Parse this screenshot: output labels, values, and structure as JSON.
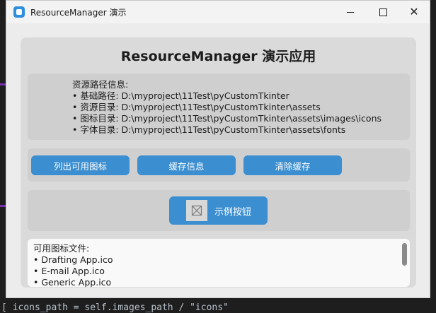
{
  "window": {
    "title": "ResourceManager 演示"
  },
  "background": {
    "code_line": "[ icons_path = self.images_path / \"icons\""
  },
  "main": {
    "heading": "ResourceManager 演示应用",
    "info": {
      "header": "资源路径信息:",
      "lines": [
        "• 基础路径: D:\\myproject\\11Test\\pyCustomTkinter",
        "• 资源目录: D:\\myproject\\11Test\\pyCustomTkinter\\assets",
        "• 图标目录: D:\\myproject\\11Test\\pyCustomTkinter\\assets\\images\\icons",
        "• 字体目录: D:\\myproject\\11Test\\pyCustomTkinter\\assets\\fonts"
      ]
    },
    "buttons": {
      "list_icons": "列出可用图标",
      "cache_info": "缓存信息",
      "clear_cache": "清除缓存"
    },
    "sample_button": {
      "label": "示例按钮",
      "icon": "missing-image-icon"
    },
    "icon_list": {
      "header": "可用图标文件:",
      "items": [
        "• Drafting App.ico",
        "• E-mail App.ico",
        "• Generic App.ico"
      ]
    }
  },
  "colors": {
    "accent": "#3b8ed0",
    "panel": "#cfcfcf",
    "frame": "#dadada"
  }
}
